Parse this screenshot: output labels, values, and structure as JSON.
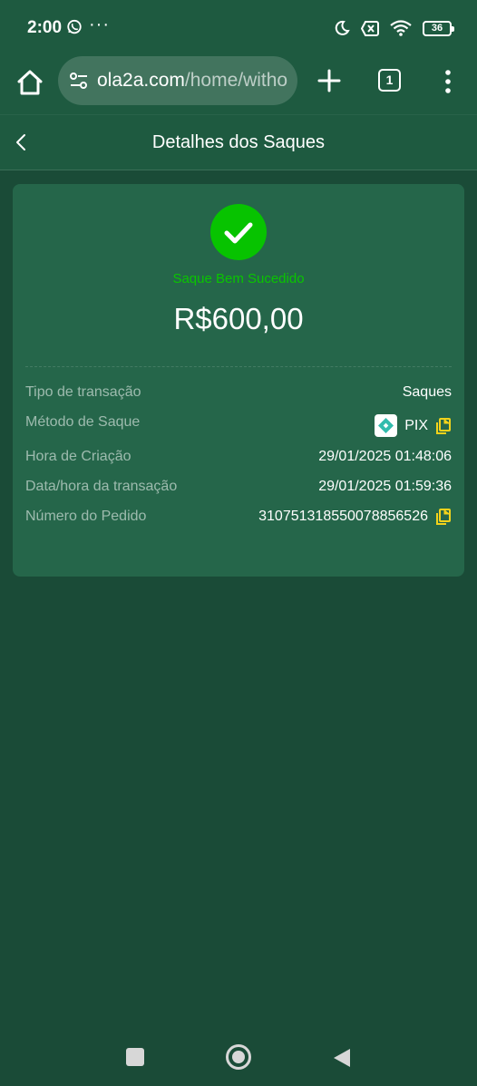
{
  "status_bar": {
    "time": "2:00",
    "icons": [
      "whatsapp-icon",
      "more-dots-icon",
      "moon-icon",
      "no-sim-icon",
      "wifi-icon"
    ],
    "battery": "36"
  },
  "browser": {
    "url_domain": "ola2a.com",
    "url_path": "/home/witho",
    "tab_count": "1"
  },
  "header": {
    "title": "Detalhes dos Saques"
  },
  "summary": {
    "status": "Saque Bem Sucedido",
    "amount": "R$600,00"
  },
  "details": [
    {
      "label": "Tipo de transação",
      "value": "Saques"
    },
    {
      "label": "Método de Saque",
      "value": "PIX"
    },
    {
      "label": "Hora de Criação",
      "value": "29/01/2025 01:48:06"
    },
    {
      "label": "Data/hora da transação",
      "value": "29/01/2025 01:59:36"
    },
    {
      "label": "Número do Pedido",
      "value": "310751318550078856526"
    }
  ],
  "colors": {
    "background": "#1a4b37",
    "bar": "#1e5a40",
    "card": "#25664a",
    "success": "#07c300",
    "copy_icon": "#f2d21b",
    "pix": "#32bcad"
  }
}
